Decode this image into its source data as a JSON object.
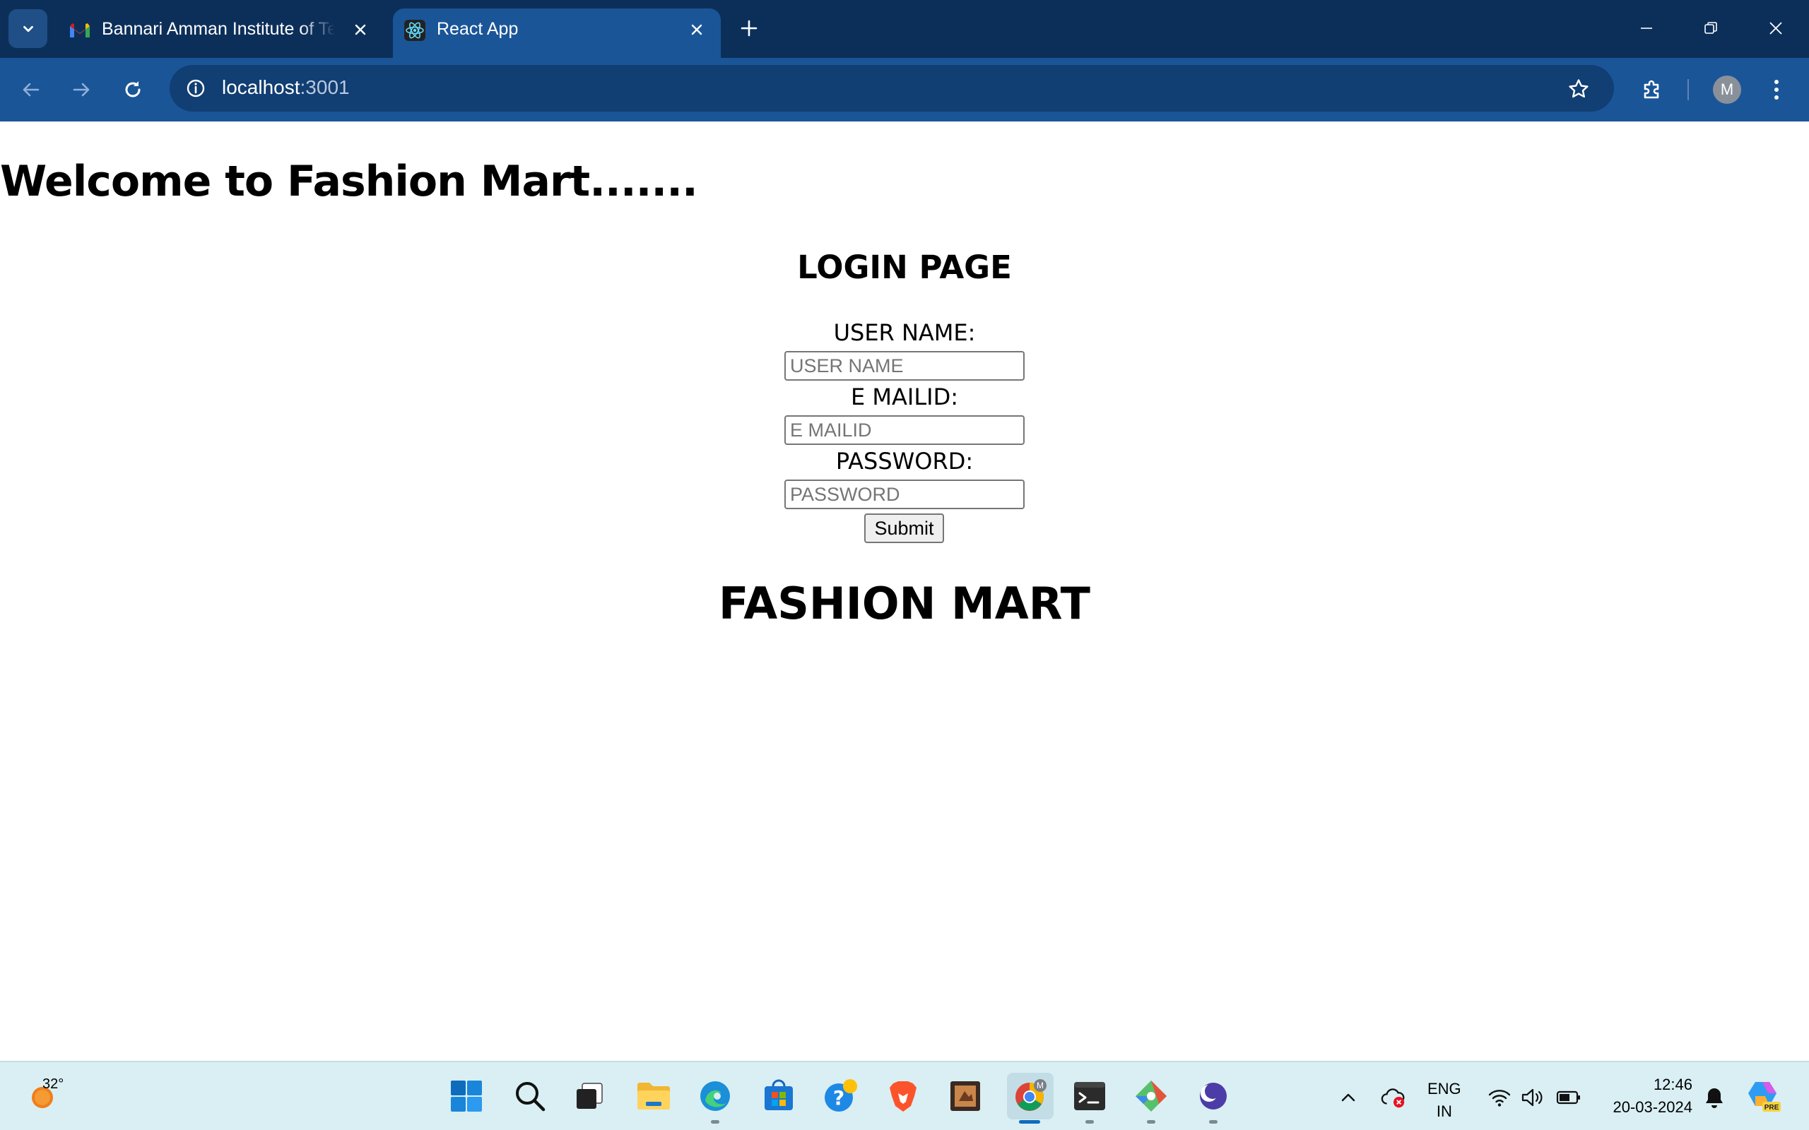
{
  "browser": {
    "tabs": [
      {
        "title": "Bannari Amman Institute of Tec",
        "favicon": "gmail-icon",
        "active": false
      },
      {
        "title": "React App",
        "favicon": "react-icon",
        "active": true
      }
    ],
    "address_host": "localhost",
    "address_port": ":3001",
    "profile_initial": "M"
  },
  "page": {
    "welcome_heading": "Welcome to Fashion Mart.......",
    "login_title": "LOGIN PAGE",
    "username_label": "USER NAME:",
    "username_placeholder": "USER NAME",
    "email_label": "E MAILID:",
    "email_placeholder": "E MAILID",
    "password_label": "PASSWORD:",
    "password_placeholder": "PASSWORD",
    "submit_label": "Submit",
    "brand_heading": "FASHION MART"
  },
  "taskbar": {
    "temperature": "32°",
    "language_line1": "ENG",
    "language_line2": "IN",
    "time": "12:46",
    "date": "20-03-2024",
    "chrome_badge": "M",
    "copilot_badge": "PRE"
  },
  "colors": {
    "tabbar": "#0c2f5a",
    "toolbar": "#1a5598",
    "omnibox": "#113e73",
    "taskbar": "#d9eff3"
  }
}
